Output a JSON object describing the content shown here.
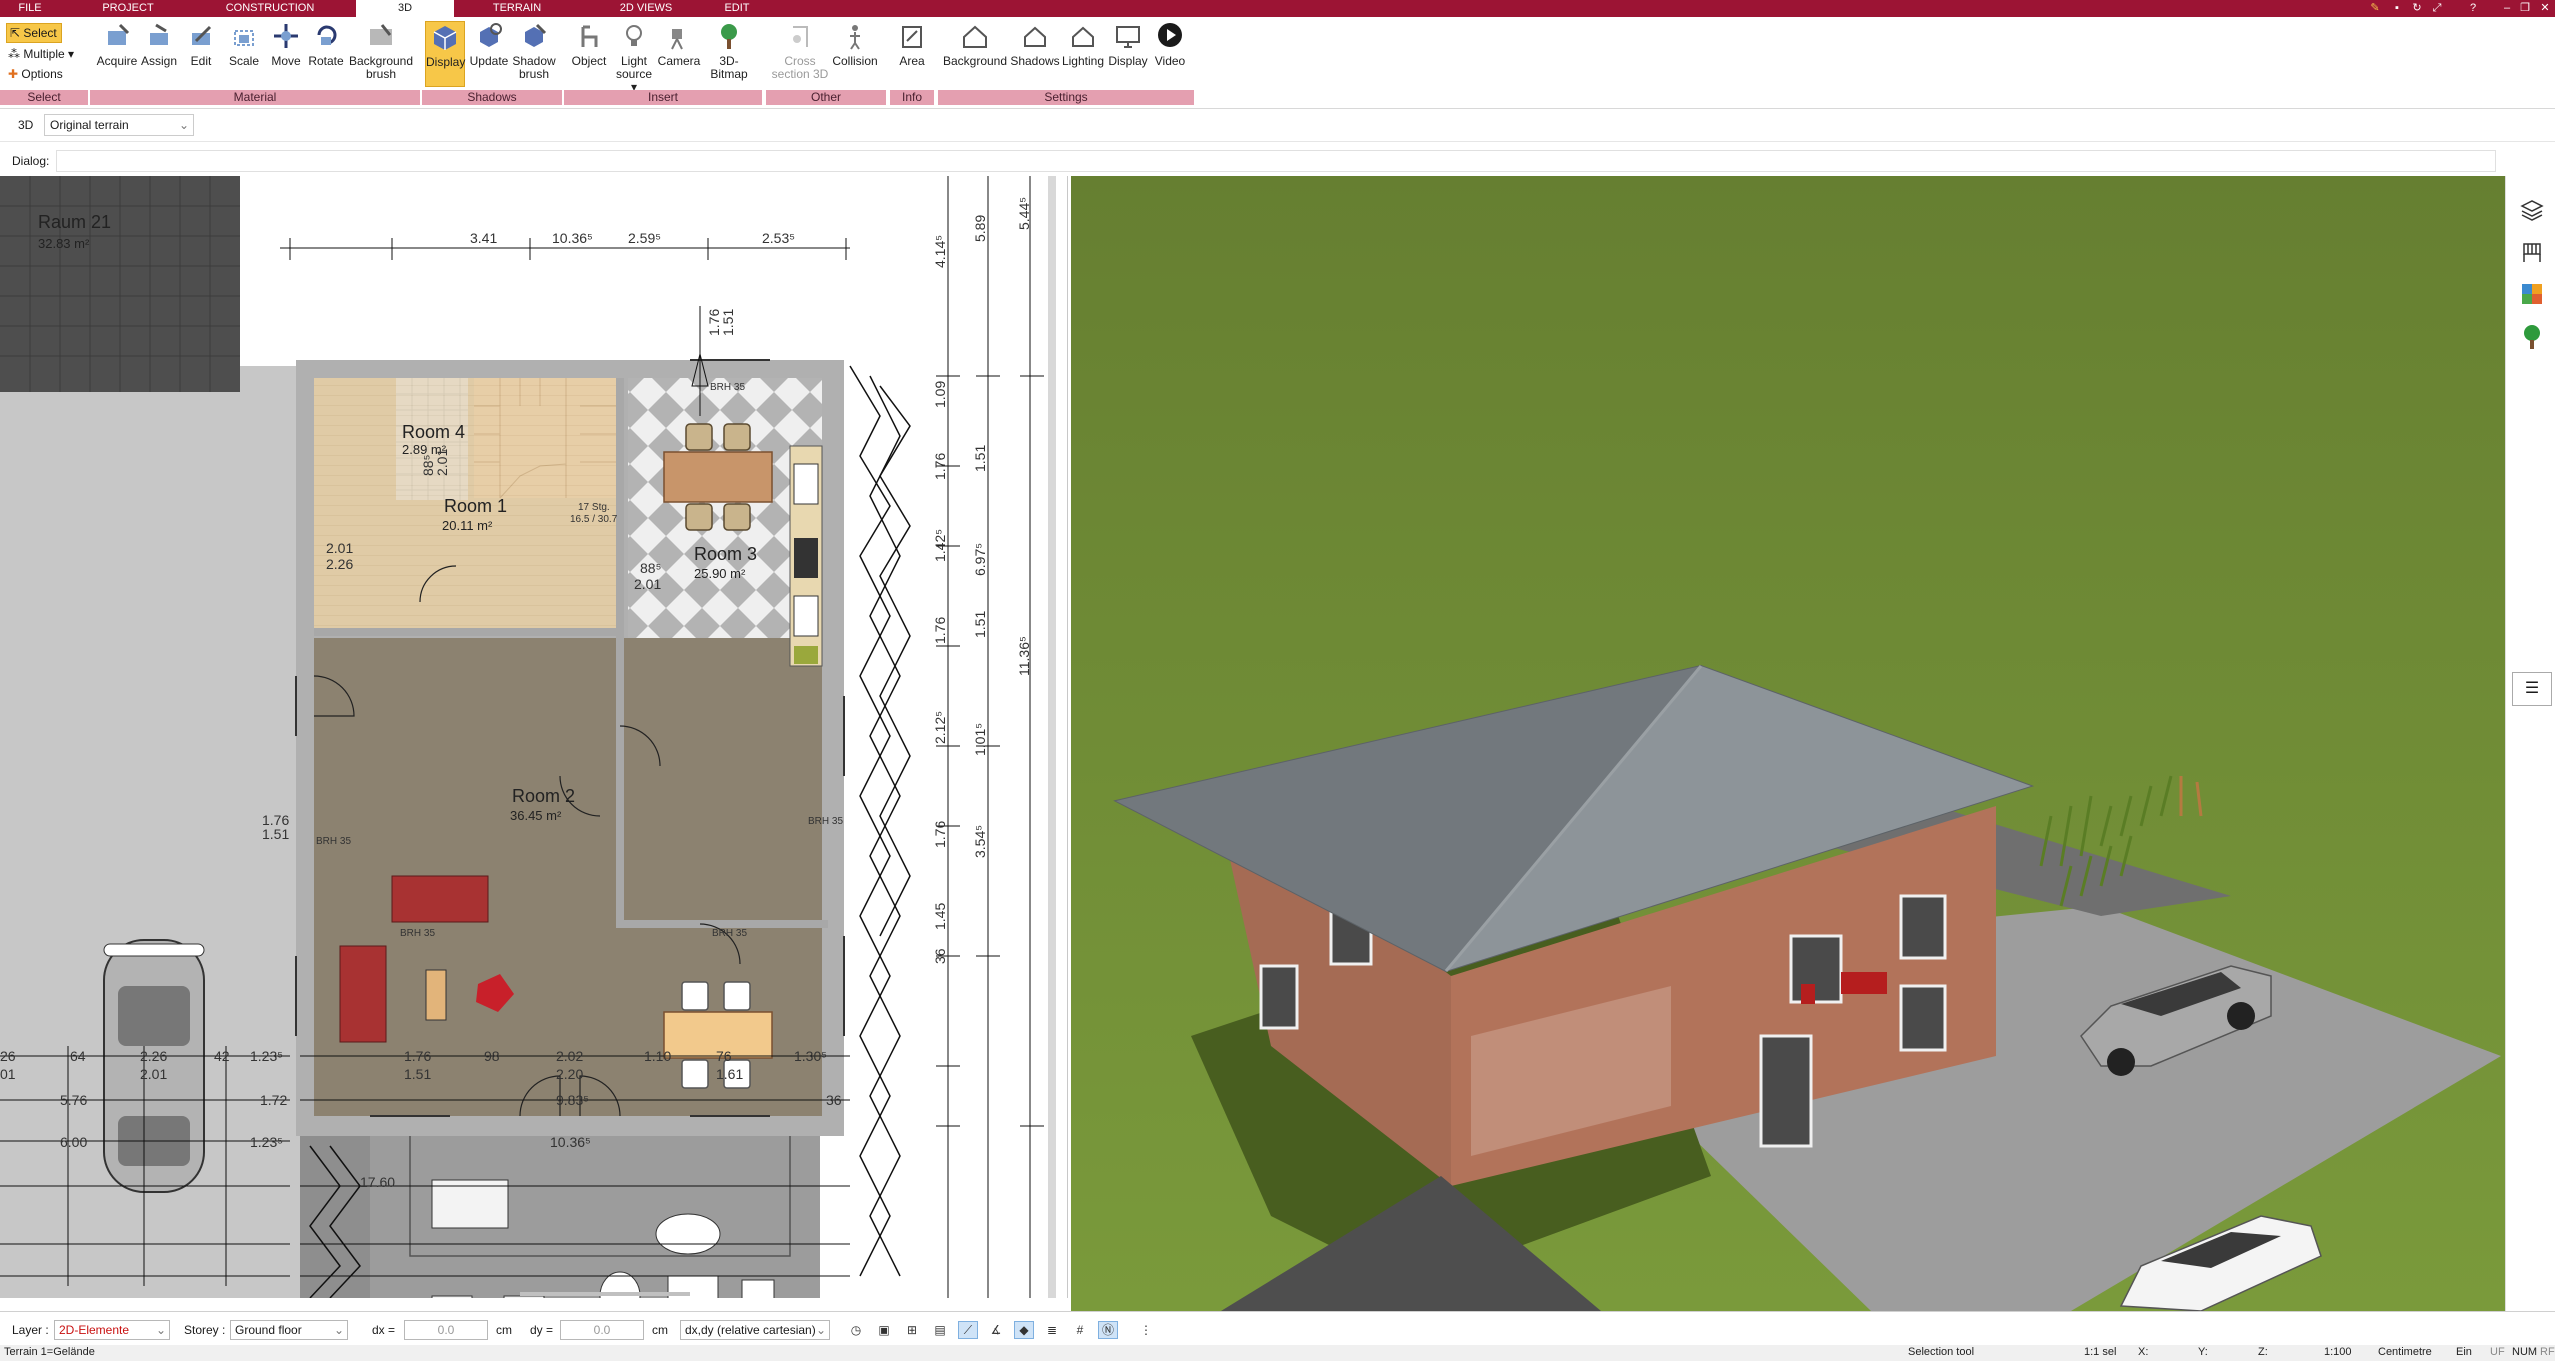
{
  "menu": {
    "tabs": [
      "FILE",
      "PROJECT",
      "CONSTRUCTION",
      "3D",
      "TERRAIN",
      "2D VIEWS",
      "EDIT"
    ],
    "active": "3D"
  },
  "ribbon": {
    "select": {
      "select": "Select",
      "multiple": "Multiple",
      "options": "Options",
      "group": "Select"
    },
    "material": {
      "group": "Material",
      "buttons": [
        "Acquire",
        "Assign",
        "Edit",
        "Scale",
        "Move",
        "Rotate",
        "Background brush"
      ]
    },
    "shadows": {
      "group": "Shadows",
      "buttons": [
        "Display",
        "Update",
        "Shadow brush"
      ]
    },
    "insert": {
      "group": "Insert",
      "buttons": [
        "Object",
        "Light source",
        "Camera",
        "3D-Bitmap"
      ]
    },
    "other": {
      "group": "Other",
      "buttons": [
        "Cross section 3D",
        "Collision"
      ]
    },
    "info": {
      "group": "Info",
      "buttons": [
        "Area"
      ]
    },
    "settings": {
      "group": "Settings",
      "buttons": [
        "Background",
        "Shadows",
        "Lighting",
        "Display",
        "Video"
      ]
    }
  },
  "toolbar": {
    "mode": "3D",
    "terrain": "Original terrain",
    "dialog_label": "Dialog:"
  },
  "plan": {
    "rooms": [
      {
        "name": "Raum 21",
        "area": "32.83 m²"
      },
      {
        "name": "Room 4",
        "area": "2.89 m²"
      },
      {
        "name": "Room 1",
        "area": "20.11 m²"
      },
      {
        "name": "Room 3",
        "area": "25.90 m²"
      },
      {
        "name": "Room 2",
        "area": "36.45 m²"
      }
    ],
    "top_dims": [
      "3.41",
      "10.36⁵",
      "2.59⁵",
      "2.53⁵"
    ],
    "right_dims_a": [
      "4.14⁵",
      "1.09",
      "1.76",
      "1.42⁵",
      "1.76",
      "2.12⁵",
      "1.76",
      "1.45",
      "36"
    ],
    "right_dims_b": [
      "5.89",
      "1.51",
      "6.97⁵",
      "1.51",
      "1.01⁵",
      "3.54⁵"
    ],
    "right_dims_c": [
      "5.44⁵",
      "11.36⁵"
    ],
    "left_dims": [
      "64",
      "2.26",
      "42",
      "1.23⁵",
      "5.76",
      "1.72",
      "6.00",
      "1.23⁵",
      "2.01",
      "26",
      "01"
    ],
    "lower_dims": [
      "1.76",
      "1.51",
      "98",
      "2.02",
      "2.20",
      "1.30⁵",
      "9.83⁵",
      "10.36⁵",
      "17.60",
      "36",
      "1.10",
      "76",
      "1.61"
    ],
    "door_labels": [
      "2.01",
      "2.26",
      "88⁵",
      "2.01",
      "88⁵",
      "2.01",
      "1.76",
      "1.51",
      "1.76",
      "1.51"
    ],
    "brh": [
      "BRH 35",
      "BRH 35",
      "BRH 35",
      "BRH 35",
      "BRH 35"
    ],
    "stair_note": [
      "17 Stg.",
      "16.5 / 30.7"
    ]
  },
  "bottombar": {
    "layer_label": "Layer :",
    "layer_value": "2D-Elemente",
    "storey_label": "Storey :",
    "storey_value": "Ground floor",
    "dx_label": "dx =",
    "dx_value": "0.0",
    "dx_unit": "cm",
    "dy_label": "dy =",
    "dy_value": "0.0",
    "dy_unit": "cm",
    "coord_mode": "dx,dy (relative cartesian)"
  },
  "statusbar": {
    "left": "Terrain 1=Gelände",
    "tool": "Selection tool",
    "scale_sel": "1:1 sel",
    "x": "X:",
    "y": "Y:",
    "z": "Z:",
    "scale": "1:100",
    "unit": "Centimetre",
    "ein": "Ein",
    "uf": "UF",
    "num": "NUM",
    "rf": "RF"
  },
  "colors": {
    "accent": "#9c1434",
    "ribbon_group": "#e49fb0",
    "active": "#f7c748",
    "grass": "#6b8a33",
    "roof": "#7d8489"
  }
}
